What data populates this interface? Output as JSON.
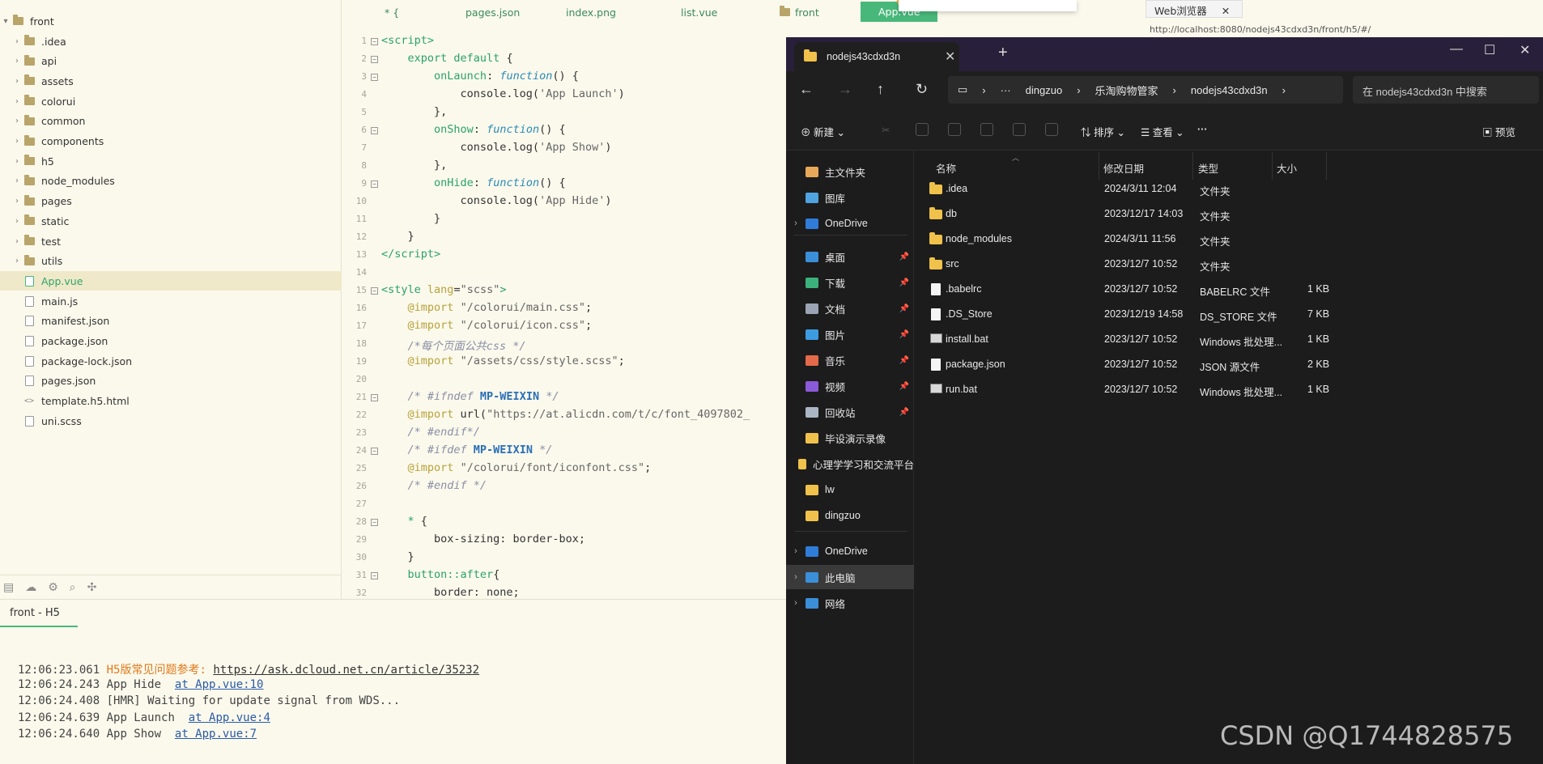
{
  "tree": {
    "root": "front",
    "items": [
      {
        "label": ".idea",
        "type": "folder"
      },
      {
        "label": "api",
        "type": "folder"
      },
      {
        "label": "assets",
        "type": "folder"
      },
      {
        "label": "colorui",
        "type": "folder"
      },
      {
        "label": "common",
        "type": "folder"
      },
      {
        "label": "components",
        "type": "folder"
      },
      {
        "label": "h5",
        "type": "folder"
      },
      {
        "label": "node_modules",
        "type": "folder"
      },
      {
        "label": "pages",
        "type": "folder"
      },
      {
        "label": "static",
        "type": "folder"
      },
      {
        "label": "test",
        "type": "folder"
      },
      {
        "label": "utils",
        "type": "folder"
      },
      {
        "label": "App.vue",
        "type": "vue"
      },
      {
        "label": "main.js",
        "type": "file"
      },
      {
        "label": "manifest.json",
        "type": "file"
      },
      {
        "label": "package.json",
        "type": "file"
      },
      {
        "label": "package-lock.json",
        "type": "file"
      },
      {
        "label": "pages.json",
        "type": "file"
      },
      {
        "label": "template.h5.html",
        "type": "code"
      },
      {
        "label": "uni.scss",
        "type": "file"
      }
    ]
  },
  "editor_tabs": [
    "* {",
    "pages.json",
    "index.png",
    "list.vue",
    "front",
    "App.vue"
  ],
  "editor_lines": [
    {
      "n": "1",
      "fold": true
    },
    {
      "n": "2",
      "fold": true
    },
    {
      "n": "3",
      "fold": true
    },
    {
      "n": "4"
    },
    {
      "n": "5"
    },
    {
      "n": "6",
      "fold": true
    },
    {
      "n": "7"
    },
    {
      "n": "8"
    },
    {
      "n": "9",
      "fold": true
    },
    {
      "n": "10"
    },
    {
      "n": "11"
    },
    {
      "n": "12"
    },
    {
      "n": "13"
    },
    {
      "n": "14"
    },
    {
      "n": "15",
      "fold": true
    },
    {
      "n": "16"
    },
    {
      "n": "17"
    },
    {
      "n": "18"
    },
    {
      "n": "19"
    },
    {
      "n": "20"
    },
    {
      "n": "21",
      "fold": true
    },
    {
      "n": "22"
    },
    {
      "n": "23"
    },
    {
      "n": "24",
      "fold": true
    },
    {
      "n": "25"
    },
    {
      "n": "26"
    },
    {
      "n": "27"
    },
    {
      "n": "28",
      "fold": true
    },
    {
      "n": "29"
    },
    {
      "n": "30"
    },
    {
      "n": "31",
      "fold": true
    },
    {
      "n": "32"
    }
  ],
  "console": {
    "tab_label": "front - H5",
    "lines": [
      {
        "time": "12:06:23.061",
        "msg": "H5版常见问题参考: ",
        "link": "https://ask.dcloud.net.cn/article/35232"
      },
      {
        "time": "12:06:24.243",
        "msg": "App Hide  ",
        "link": "at App.vue:10"
      },
      {
        "time": "12:06:24.408",
        "msg": "[HMR] Waiting for update signal from WDS...",
        "link": ""
      },
      {
        "time": "12:06:24.639",
        "msg": "App Launch  ",
        "link": "at App.vue:4"
      },
      {
        "time": "12:06:24.640",
        "msg": "App Show  ",
        "link": "at App.vue:7"
      }
    ]
  },
  "browser": {
    "tab_label": "Web浏览器",
    "url": "http://localhost:8080/nodejs43cdxd3n/front/h5/#/"
  },
  "explorer": {
    "tab_title": "nodejs43cdxd3n",
    "breadcrumb": [
      "dingzuo",
      "乐淘购物管家",
      "nodejs43cdxd3n"
    ],
    "search_placeholder": "在 nodejs43cdxd3n 中搜索",
    "commands": {
      "new": "新建",
      "sort": "排序",
      "view": "查看",
      "preview": "预览"
    },
    "columns": {
      "name": "名称",
      "date": "修改日期",
      "type": "类型",
      "size": "大小"
    },
    "nav": [
      {
        "label": "主文件夹",
        "pinned": false,
        "icon": "home-icon",
        "color": "#e8a85a"
      },
      {
        "label": "图库",
        "pinned": false,
        "icon": "gallery-icon",
        "color": "#4fa3e0"
      },
      {
        "label": "OneDrive",
        "pinned": false,
        "icon": "onedrive-icon",
        "color": "#2f7dd8",
        "chevron": true
      },
      {
        "label": "桌面",
        "pinned": true,
        "icon": "desktop-icon",
        "color": "#3b8fd9"
      },
      {
        "label": "下载",
        "pinned": true,
        "icon": "download-icon",
        "color": "#3bb27b"
      },
      {
        "label": "文档",
        "pinned": true,
        "icon": "documents-icon",
        "color": "#9aa4b4"
      },
      {
        "label": "图片",
        "pinned": true,
        "icon": "pictures-icon",
        "color": "#3d9be0"
      },
      {
        "label": "音乐",
        "pinned": true,
        "icon": "music-icon",
        "color": "#e36a4a"
      },
      {
        "label": "视频",
        "pinned": true,
        "icon": "videos-icon",
        "color": "#8a5ad8"
      },
      {
        "label": "回收站",
        "pinned": true,
        "icon": "recycle-bin-icon",
        "color": "#aab6c4"
      },
      {
        "label": "毕设演示录像",
        "pinned": false,
        "icon": "folder-icon",
        "color": "#f0c24b"
      },
      {
        "label": "心理学学习和交流平台",
        "pinned": false,
        "icon": "folder-icon",
        "color": "#f0c24b"
      },
      {
        "label": "lw",
        "pinned": false,
        "icon": "folder-icon",
        "color": "#f0c24b"
      },
      {
        "label": "dingzuo",
        "pinned": false,
        "icon": "folder-icon",
        "color": "#f0c24b"
      },
      {
        "label": "OneDrive",
        "pinned": false,
        "icon": "onedrive-icon",
        "color": "#2f7dd8",
        "chevron": true
      },
      {
        "label": "此电脑",
        "pinned": false,
        "icon": "this-pc-icon",
        "color": "#3b8fd9",
        "chevron": true,
        "selected": true
      },
      {
        "label": "网络",
        "pinned": false,
        "icon": "network-icon",
        "color": "#3b8fd9",
        "chevron": true
      }
    ],
    "files": [
      {
        "name": ".idea",
        "date": "2024/3/11 12:04",
        "type": "文件夹",
        "size": "",
        "kind": "folder"
      },
      {
        "name": "db",
        "date": "2023/12/17 14:03",
        "type": "文件夹",
        "size": "",
        "kind": "folder"
      },
      {
        "name": "node_modules",
        "date": "2024/3/11 11:56",
        "type": "文件夹",
        "size": "",
        "kind": "folder"
      },
      {
        "name": "src",
        "date": "2023/12/7 10:52",
        "type": "文件夹",
        "size": "",
        "kind": "folder"
      },
      {
        "name": ".babelrc",
        "date": "2023/12/7 10:52",
        "type": "BABELRC 文件",
        "size": "1 KB",
        "kind": "file"
      },
      {
        "name": ".DS_Store",
        "date": "2023/12/19 14:58",
        "type": "DS_STORE 文件",
        "size": "7 KB",
        "kind": "file"
      },
      {
        "name": "install.bat",
        "date": "2023/12/7 10:52",
        "type": "Windows 批处理...",
        "size": "1 KB",
        "kind": "bat"
      },
      {
        "name": "package.json",
        "date": "2023/12/7 10:52",
        "type": "JSON 源文件",
        "size": "2 KB",
        "kind": "file"
      },
      {
        "name": "run.bat",
        "date": "2023/12/7 10:52",
        "type": "Windows 批处理...",
        "size": "1 KB",
        "kind": "bat"
      }
    ]
  },
  "watermark": "CSDN @Q1744828575",
  "colors": {
    "accent_green": "#48b87a",
    "explorer_bg": "#1c1c1c",
    "ide_bg": "#fbf9ec"
  }
}
